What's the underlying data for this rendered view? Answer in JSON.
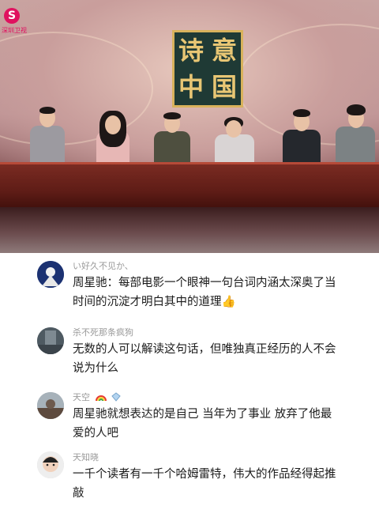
{
  "video": {
    "logo_text": "深圳卫视",
    "sign_chars": [
      "诗",
      "意",
      "中",
      "国"
    ]
  },
  "comments": [
    {
      "username": "い好久不见か、",
      "text": "周星驰：每部电影一个眼神一句台词内涵太深奥了当时间的沉淀才明白其中的道理",
      "emoji": "👍",
      "badges": []
    },
    {
      "username": "杀不死那条疯狗",
      "text": "无数的人可以解读这句话，但唯独真正经历的人不会说为什么",
      "emoji": "",
      "badges": []
    },
    {
      "username": "天空",
      "text": "周星驰就想表达的是自己 当年为了事业 放弃了他最爱的人吧",
      "emoji": "",
      "badges": [
        "rainbow-badge",
        "diamond-badge"
      ]
    },
    {
      "username": "天知晓",
      "text": "一千个读者有一千个哈姆雷特，伟大的作品经得起推敲",
      "emoji": "",
      "badges": []
    }
  ]
}
